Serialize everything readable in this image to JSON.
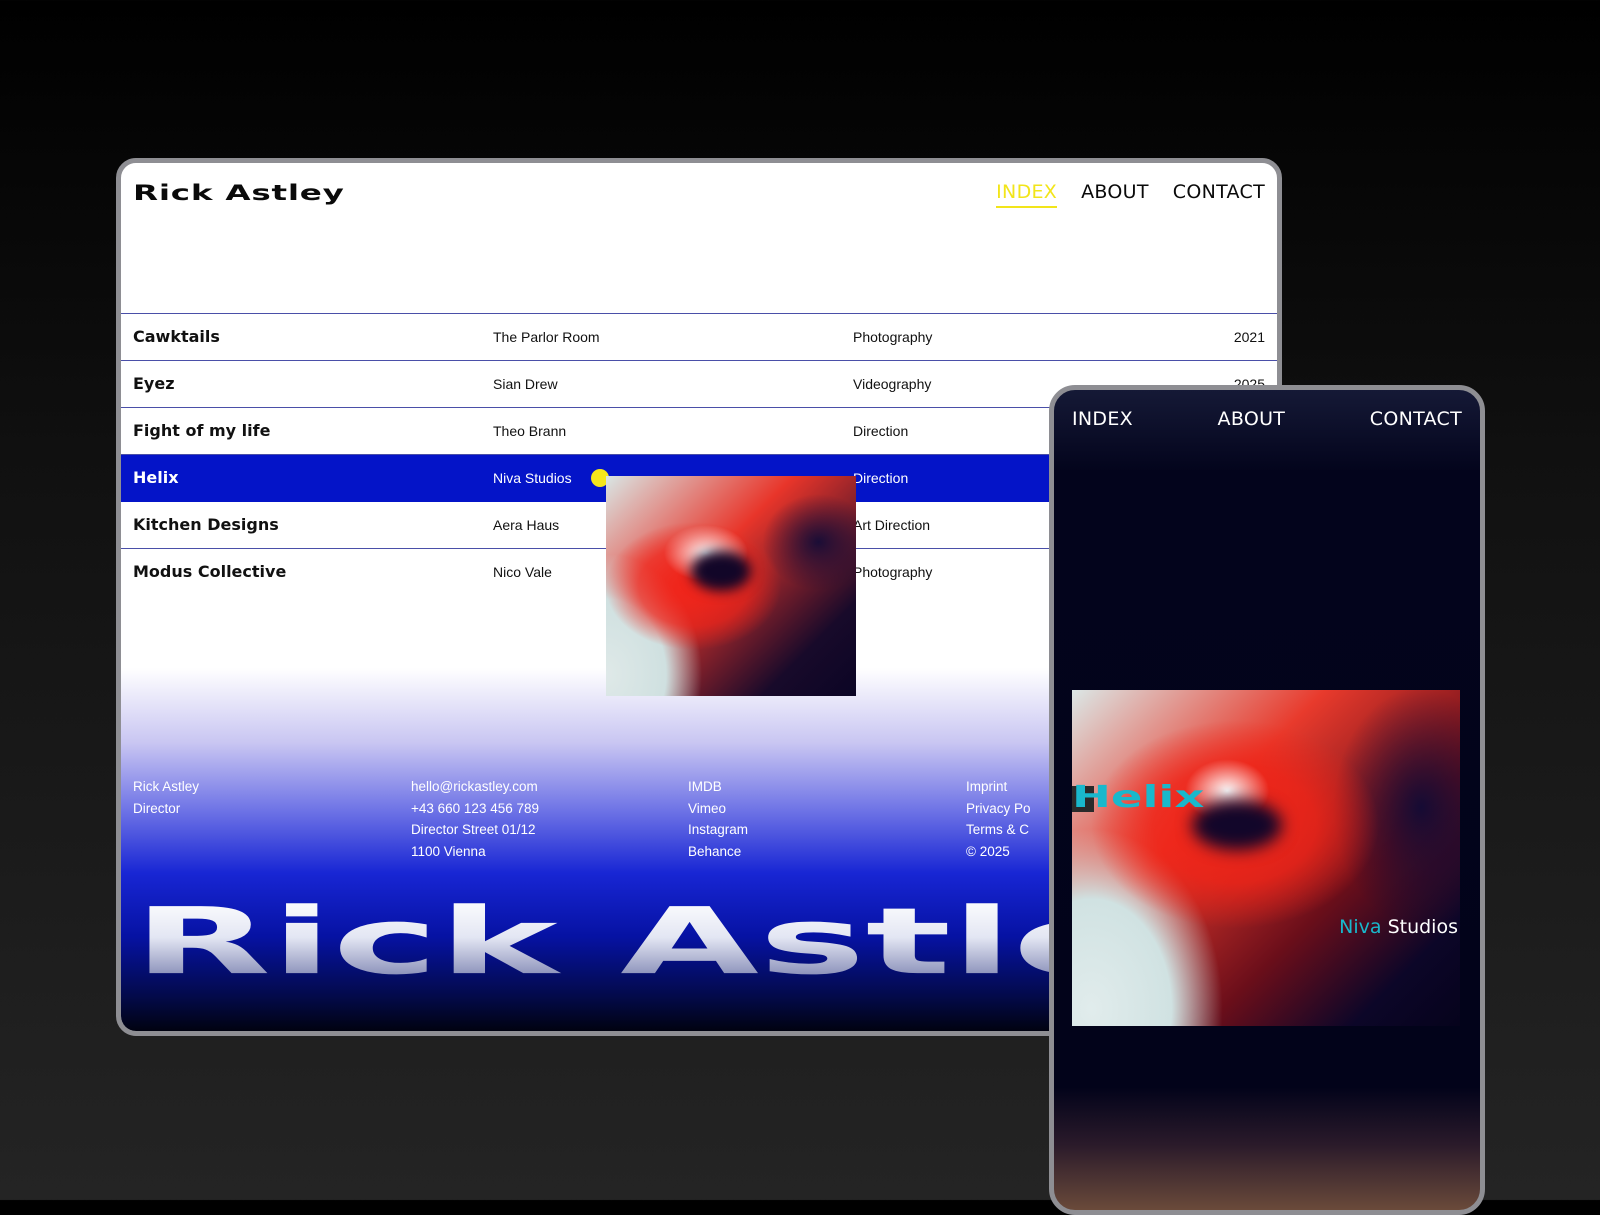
{
  "colors": {
    "accent_yellow": "#f2e51a",
    "active_row_blue": "#0414c8",
    "mobile_title_cyan": "#19b8cc"
  },
  "desktop": {
    "logo": "Rick Astley",
    "nav": [
      {
        "label": "INDEX",
        "active": true
      },
      {
        "label": "ABOUT",
        "active": false
      },
      {
        "label": "CONTACT",
        "active": false
      }
    ],
    "projects": [
      {
        "title": "Cawktails",
        "client": "The Parlor Room",
        "category": "Photography",
        "year": "2021"
      },
      {
        "title": "Eyez",
        "client": "Sian Drew",
        "category": "Videography",
        "year": "2025"
      },
      {
        "title": "Fight of my life",
        "client": "Theo Brann",
        "category": "Direction",
        "year": ""
      },
      {
        "title": "Helix",
        "client": "Niva Studios",
        "category": "Direction",
        "year": ""
      },
      {
        "title": "Kitchen Designs",
        "client": "Aera Haus",
        "category": "Art Direction",
        "year": ""
      },
      {
        "title": "Modus Collective",
        "client": "Nico Vale",
        "category": "Photography",
        "year": ""
      }
    ],
    "active_project_index": 3,
    "footer": {
      "identity": {
        "name": "Rick Astley",
        "role": "Director"
      },
      "contact": {
        "email": "hello@rickastley.com",
        "phone": "+43 660 123 456 789",
        "street": "Director Street 01/12",
        "city": "1100 Vienna"
      },
      "social": [
        "IMDB",
        "Vimeo",
        "Instagram",
        "Behance"
      ],
      "legal": [
        "Imprint",
        "Privacy Po",
        "Terms & C",
        "© 2025"
      ]
    },
    "big_name": "Rick Astle"
  },
  "mobile": {
    "nav": [
      "INDEX",
      "ABOUT",
      "CONTACT"
    ],
    "project_title": "Helix",
    "client_accent": "Niva",
    "client_rest": " Studios"
  }
}
